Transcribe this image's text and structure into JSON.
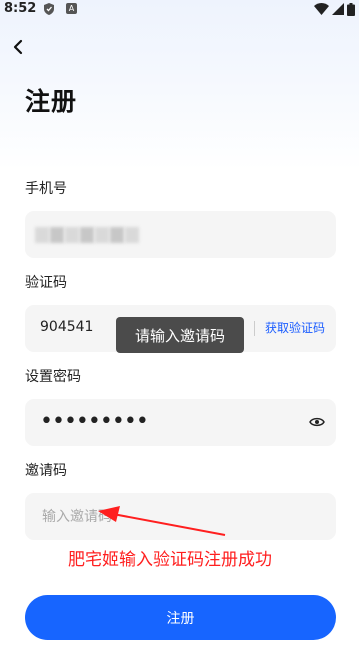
{
  "status_bar": {
    "time": "8:52",
    "a_label": "A"
  },
  "page": {
    "title": "注册"
  },
  "phone": {
    "label": "手机号"
  },
  "verification": {
    "label": "验证码",
    "value": "904541",
    "get_code_label": "获取验证码"
  },
  "password": {
    "label": "设置密码",
    "value": "•••••••••"
  },
  "invite": {
    "label": "邀请码",
    "placeholder": "输入邀请码"
  },
  "toast": {
    "text": "请输入邀请码"
  },
  "annotation": {
    "text": "肥宅姬输入验证码注册成功",
    "color": "#ff1f1f"
  },
  "register_button": {
    "label": "注册",
    "color": "#1765ff"
  }
}
